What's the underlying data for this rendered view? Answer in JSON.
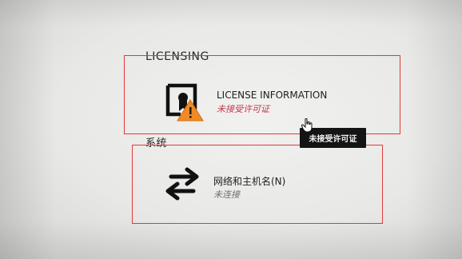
{
  "sections": {
    "licensing_title": "LICENSING",
    "system_title": "系统"
  },
  "license_tile": {
    "label": "LICENSE INFORMATION",
    "status": "未接受许可证",
    "icon": "license-warning-icon",
    "status_color": "#c8354c"
  },
  "network_tile": {
    "label": "网络和主机名(N)",
    "status": "未连接",
    "icon": "network-arrows-icon"
  },
  "tooltip": {
    "text": "未接受许可证"
  },
  "colors": {
    "highlight_border": "#e03a3a",
    "background": "#e8e8e6",
    "tooltip_bg": "#141414"
  }
}
